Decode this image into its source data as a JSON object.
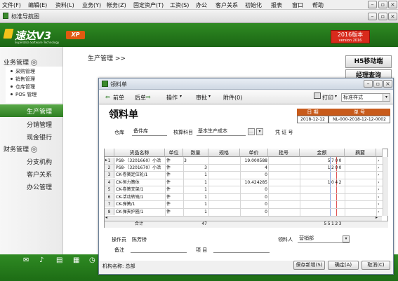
{
  "menu": [
    "文件(F)",
    "编辑(E)",
    "资料(L)",
    "业务(Y)",
    "帐务(Z)",
    "固定资产(T)",
    "工资(S)",
    "办公",
    "客户关系",
    "初始化",
    "报表",
    "窗口",
    "帮助"
  ],
  "nav_tab": {
    "label": "标准导航图"
  },
  "brand": {
    "name": "速达V3",
    "edition": "XP",
    "tagline": "Superdata Software Technology",
    "version_badge_1": "2016版本",
    "version_badge_2": "version 2016"
  },
  "sidebar": {
    "business_header": "业务管理",
    "business_items": [
      "采购管理",
      "销售管理",
      "仓库管理",
      "POS 管理"
    ],
    "items": [
      "生产管理",
      "分销管理",
      "现金银行"
    ],
    "finance_header": "财务管理",
    "finance_items": [
      "分支机构",
      "客户关系",
      "办公管理"
    ],
    "collapse_glyph": "⊗"
  },
  "breadcrumb": "生产管理 >>",
  "right_buttons": [
    "H5移动端",
    "经理查询"
  ],
  "dialog": {
    "title": "领料单",
    "toolbar": {
      "prev": "前单",
      "next": "后单",
      "operate": "操作",
      "review": "审批",
      "attach": "附件(0)",
      "print": "打印",
      "style": "标准样式"
    },
    "form_title": "领料单",
    "date_label": "日 期",
    "no_label": "单 号",
    "date_value": "2018-12-12",
    "no_value": "NL-000-2018-12-12-0002",
    "warehouse_label": "仓库",
    "warehouse_value": "备件库",
    "account_label": "核算科目",
    "account_value": "基本生产成本",
    "voucher_label": "凭 证 号",
    "columns": [
      "货品名称",
      "单位",
      "数量",
      "规格",
      "单价",
      "批号",
      "金额",
      "摘要"
    ],
    "rows": [
      {
        "n": "1",
        "name": "PS8-（3201660）小活",
        "unit": "件",
        "qty": "3",
        "price": "19.000588",
        "amount": "5700"
      },
      {
        "n": "2",
        "name": "PS8-（3201670）小活",
        "unit": "件",
        "qty": "3",
        "price": "4",
        "amount": "1200"
      },
      {
        "n": "3",
        "name": "CK-卷簧定位轮/1",
        "unit": "件",
        "qty": "1",
        "price": "0",
        "amount": ""
      },
      {
        "n": "4",
        "name": "CK-恒力簧体",
        "unit": "件",
        "qty": "1",
        "price": "10.424285",
        "amount": "1042"
      },
      {
        "n": "5",
        "name": "CK-卷簧支架/1",
        "unit": "件",
        "qty": "1",
        "price": "0",
        "amount": ""
      },
      {
        "n": "6",
        "name": "CK-活动转销/1",
        "unit": "件",
        "qty": "1",
        "price": "0",
        "amount": ""
      },
      {
        "n": "7",
        "name": "CK-弹簧/1",
        "unit": "件",
        "qty": "1",
        "price": "0",
        "amount": ""
      },
      {
        "n": "8",
        "name": "CK-弹夹护圈/1",
        "unit": "件",
        "qty": "1",
        "price": "0",
        "amount": ""
      }
    ],
    "total_label": "合计",
    "total_qty": "47",
    "total_amount": "55123",
    "operator_label": "操作员",
    "operator_value": "陈芳桥",
    "receiver_label": "领料人",
    "receiver_value": "营销部",
    "remark_label": "备注",
    "project_label": "项  目",
    "org_label": "机构名称: 总部",
    "buttons": [
      "保存新增(S)",
      "确定(A)",
      "取消(C)"
    ]
  }
}
